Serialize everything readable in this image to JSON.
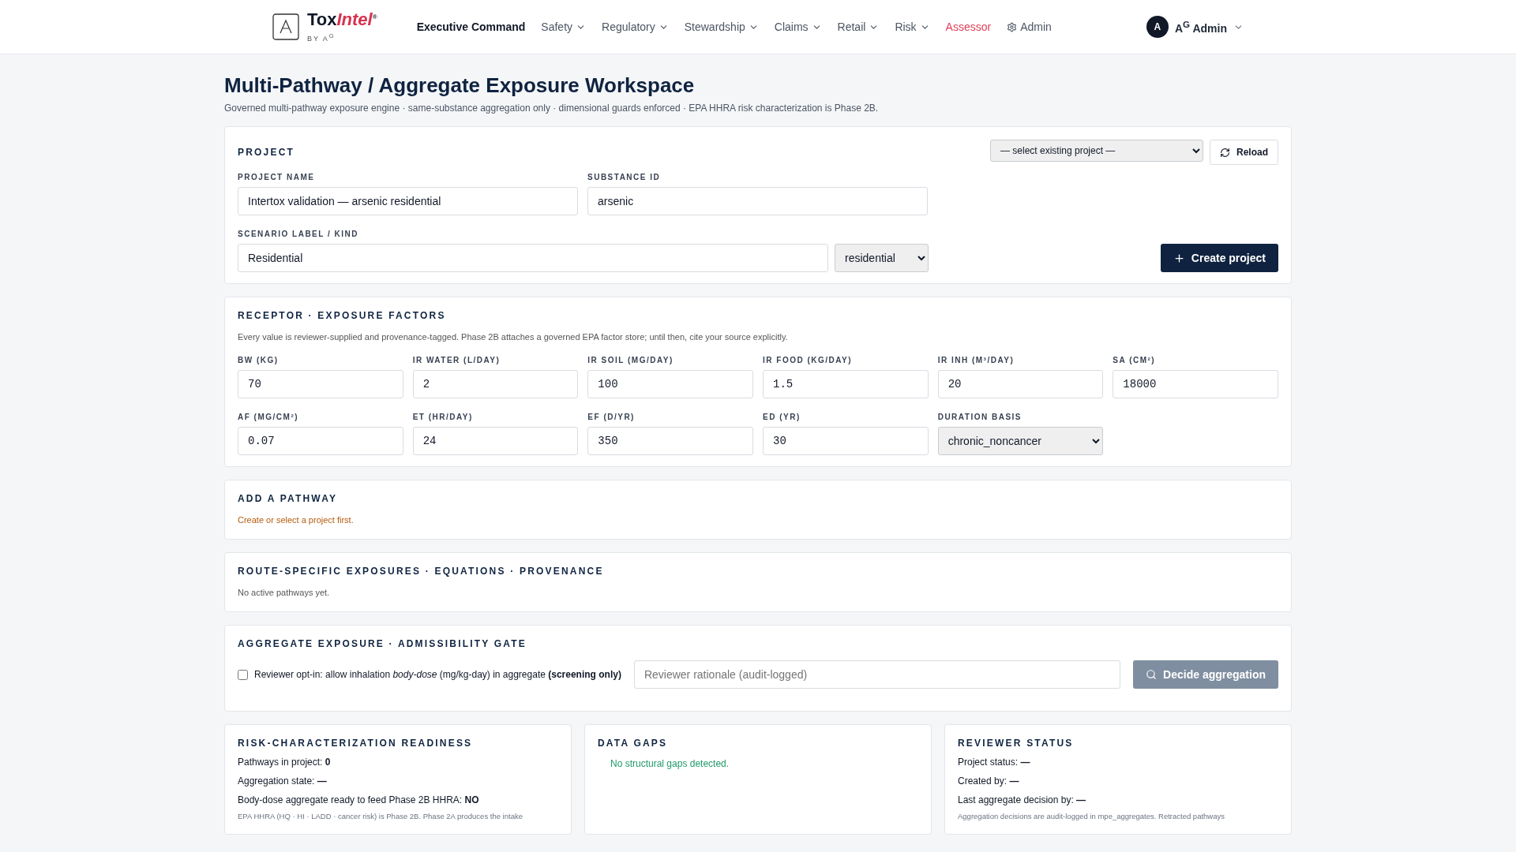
{
  "header": {
    "logo": {
      "name_plain": "Tox",
      "name_accent": "Intel",
      "registered": "®",
      "byline": "BY A$^{G}$"
    },
    "nav": [
      {
        "label": "Executive Command",
        "kind": "plain",
        "selected": true
      },
      {
        "label": "Safety",
        "kind": "menu",
        "selected": false
      },
      {
        "label": "Regulatory",
        "kind": "menu",
        "selected": false
      },
      {
        "label": "Stewardship",
        "kind": "menu",
        "selected": false
      },
      {
        "label": "Claims",
        "kind": "menu",
        "selected": false
      },
      {
        "label": "Retail",
        "kind": "menu",
        "selected": false
      },
      {
        "label": "Risk",
        "kind": "menu",
        "selected": false
      },
      {
        "label": "Assessor",
        "kind": "accent",
        "selected": false
      },
      {
        "label": "Admin",
        "kind": "settings",
        "selected": false
      }
    ],
    "user": {
      "initial": "A",
      "name": "A$^{G}$ Admin"
    }
  },
  "page": {
    "title": "Multi-Pathway / Aggregate Exposure Workspace",
    "subtitle": "Governed multi-pathway exposure engine · same-substance aggregation only · dimensional guards enforced · EPA HHRA risk characterization is Phase 2B."
  },
  "project": {
    "heading": "PROJECT",
    "existing_select": "— select existing project —",
    "reload_button": "Reload",
    "project_name": {
      "label": "PROJECT NAME",
      "value": "Intertox validation — arsenic residential"
    },
    "substance_id": {
      "label": "SUBSTANCE ID",
      "value": "arsenic"
    },
    "scenario": {
      "label": "SCENARIO LABEL / KIND",
      "value": "Residential",
      "kind_select": "residential"
    },
    "create_button": "Create project"
  },
  "receptor": {
    "heading": "RECEPTOR · EXPOSURE FACTORS",
    "note": "Every value is reviewer-supplied and provenance-tagged. Phase 2B attaches a governed EPA factor store; until then, cite your source explicitly.",
    "fields": [
      {
        "label": "BW (KG)",
        "value": "70",
        "kind": "input"
      },
      {
        "label": "IR WATER (L/DAY)",
        "value": "2",
        "kind": "input"
      },
      {
        "label": "IR SOIL (MG/DAY)",
        "value": "100",
        "kind": "input"
      },
      {
        "label": "IR FOOD (KG/DAY)",
        "value": "1.5",
        "kind": "input"
      },
      {
        "label": "IR INH (M³/DAY)",
        "value": "20",
        "kind": "input"
      },
      {
        "label": "SA (CM²)",
        "value": "18000",
        "kind": "input"
      },
      {
        "label": "AF (MG/CM²)",
        "value": "0.07",
        "kind": "input"
      },
      {
        "label": "ET (HR/DAY)",
        "value": "24",
        "kind": "input"
      },
      {
        "label": "EF (D/YR)",
        "value": "350",
        "kind": "input"
      },
      {
        "label": "ED (YR)",
        "value": "30",
        "kind": "input"
      },
      {
        "label": "DURATION BASIS",
        "value": "chronic_noncancer",
        "kind": "select"
      }
    ]
  },
  "add_pathway": {
    "heading": "ADD A PATHWAY",
    "message": "Create or select a project first."
  },
  "route_exposures": {
    "heading": "ROUTE-SPECIFIC EXPOSURES · EQUATIONS · PROVENANCE",
    "message": "No active pathways yet."
  },
  "aggregate": {
    "heading": "AGGREGATE EXPOSURE · ADMISSIBILITY GATE",
    "opt_in": {
      "label": "Reviewer opt-in: allow inhalation *body-dose* (mg/kg-day) in aggregate **(screening only)**",
      "checked": false
    },
    "rationale_placeholder": "Reviewer rationale (audit-logged)",
    "decide_button": {
      "label": "Decide aggregation",
      "disabled": true
    }
  },
  "panels": [
    {
      "heading": "RISK-CHARACTERIZATION READINESS",
      "lines": [
        "Pathways in project: **0**",
        "Aggregation state: **—**",
        "Body-dose aggregate ready to feed Phase 2B HHRA: **NO**"
      ],
      "note": "EPA HHRA (HQ · HI · LADD · cancer risk) is Phase 2B. Phase 2A produces the intake",
      "kind": "list"
    },
    {
      "heading": "DATA GAPS",
      "lines": [
        "No structural gaps detected."
      ],
      "kind": "status"
    },
    {
      "heading": "REVIEWER STATUS",
      "lines": [
        "Project status: **—**",
        "Created by: **—**",
        "Last aggregate decision by: **—**"
      ],
      "note": "Aggregation decisions are audit-logged in mpe_aggregates. Retracted pathways",
      "kind": "list"
    }
  ]
}
